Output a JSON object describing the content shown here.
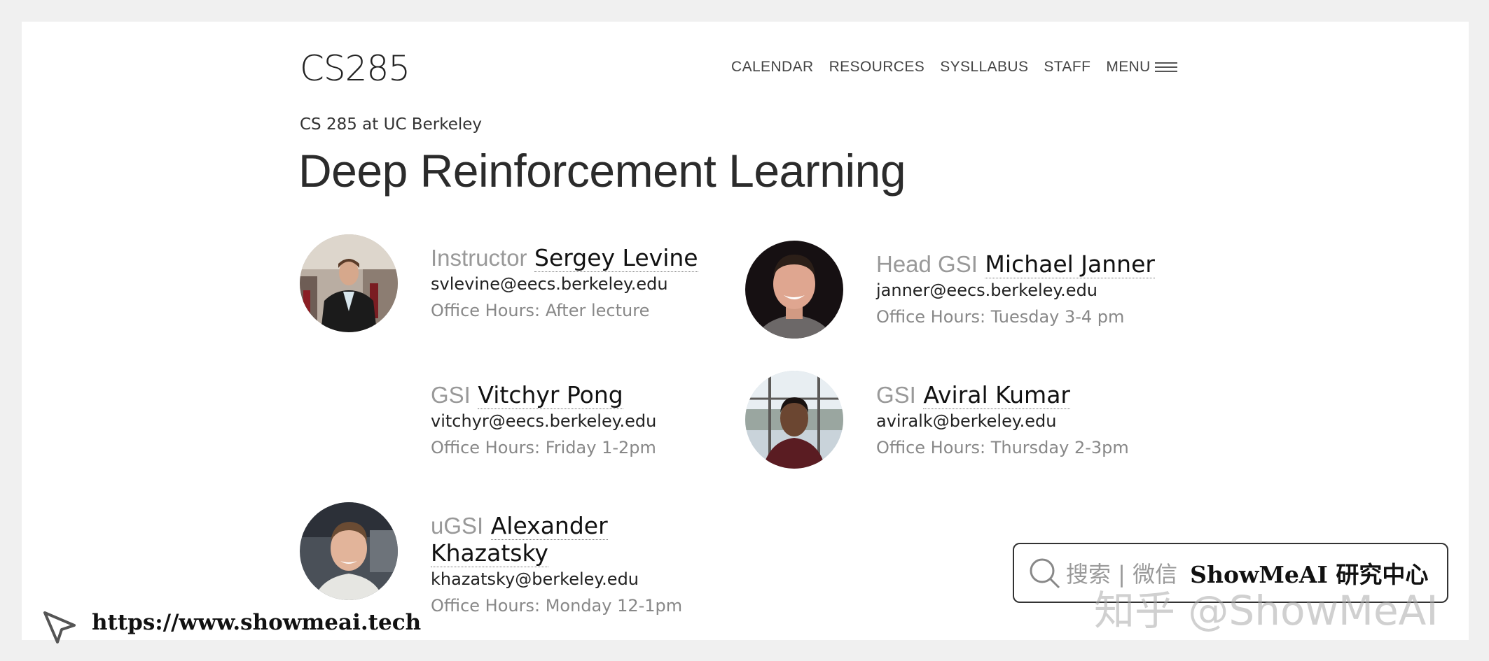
{
  "header": {
    "brand": "CS285",
    "nav": [
      "CALENDAR",
      "RESOURCES",
      "SYSLLABUS",
      "STAFF"
    ],
    "menu_label": "MENU"
  },
  "page": {
    "subtitle": "CS 285 at UC Berkeley",
    "title": "Deep Reinforcement Learning"
  },
  "staff": [
    {
      "role": "Instructor",
      "name": "Sergey Levine",
      "email": "svlevine@eecs.berkeley.edu",
      "hours": "Office Hours: After lecture"
    },
    {
      "role": "Head GSI",
      "name": "Michael Janner",
      "email": "janner@eecs.berkeley.edu",
      "hours": "Office Hours: Tuesday 3-4 pm"
    },
    {
      "role": "GSI",
      "name": "Vitchyr Pong",
      "email": "vitchyr@eecs.berkeley.edu",
      "hours": "Office Hours: Friday 1-2pm"
    },
    {
      "role": "GSI",
      "name": "Aviral Kumar",
      "email": "aviralk@berkeley.edu",
      "hours": "Office Hours: Thursday 2-3pm"
    },
    {
      "role": "uGSI",
      "name_line1": "Alexander",
      "name_line2": "Khazatsky",
      "email": "khazatsky@berkeley.edu",
      "hours": "Office Hours: Monday 12-1pm"
    }
  ],
  "watermark": {
    "search_text": "搜索 | 微信",
    "brand_text": "ShowMeAI 研究中心",
    "overlay_text": "知乎 @ShowMeAI",
    "url": "https://www.showmeai.tech"
  }
}
